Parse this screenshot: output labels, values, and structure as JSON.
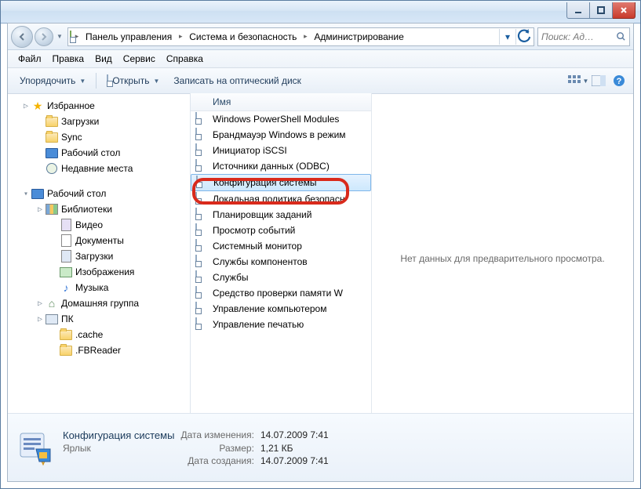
{
  "breadcrumbs": [
    "Панель управления",
    "Система и безопасность",
    "Администрирование"
  ],
  "search_placeholder": "Поиск: Ад…",
  "menubar": {
    "file": "Файл",
    "edit": "Правка",
    "view": "Вид",
    "tools": "Сервис",
    "help": "Справка"
  },
  "toolbar": {
    "organize": "Упорядочить",
    "open": "Открыть",
    "burn": "Записать на оптический диск"
  },
  "sidebar": {
    "favorites": {
      "label": "Избранное",
      "items": [
        "Загрузки",
        "Sync",
        "Рабочий стол",
        "Недавние места"
      ]
    },
    "desktop": {
      "label": "Рабочий стол"
    },
    "libraries": {
      "label": "Библиотеки",
      "items": [
        "Видео",
        "Документы",
        "Загрузки",
        "Изображения",
        "Музыка"
      ]
    },
    "homegroup": "Домашняя группа",
    "pc": {
      "label": "ПК",
      "items": [
        ".cache",
        ".FBReader"
      ]
    }
  },
  "column_header": "Имя",
  "files": [
    "Windows PowerShell Modules",
    "Брандмауэр Windows в режим",
    "Инициатор iSCSI",
    "Источники данных (ODBC)",
    "Конфигурация системы",
    "Локальная политика безопасн",
    "Планировщик заданий",
    "Просмотр событий",
    "Системный монитор",
    "Службы компонентов",
    "Службы",
    "Средство проверки памяти W",
    "Управление компьютером",
    "Управление печатью"
  ],
  "selected_index": 4,
  "preview_empty": "Нет данных для предварительного просмотра.",
  "details": {
    "name": "Конфигурация системы",
    "type": "Ярлык",
    "labels": {
      "modified": "Дата изменения:",
      "size": "Размер:",
      "created": "Дата создания:"
    },
    "modified": "14.07.2009 7:41",
    "size": "1,21 КБ",
    "created": "14.07.2009 7:41"
  }
}
